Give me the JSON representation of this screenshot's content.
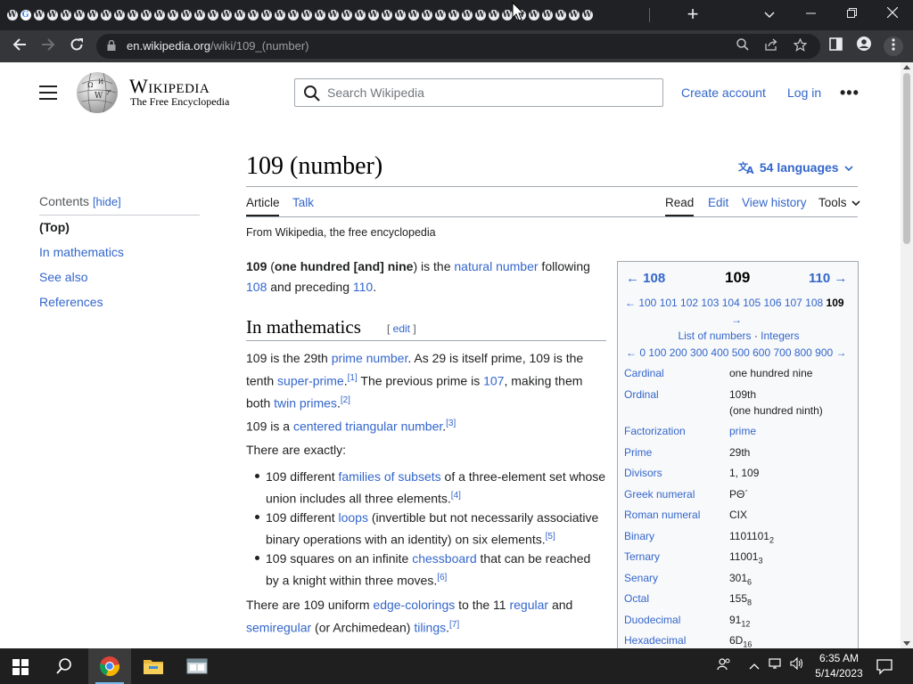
{
  "browser": {
    "tab_count": 44,
    "new_tab": "+",
    "url_host": "en.wikipedia.org",
    "url_path": "/wiki/109_(number)"
  },
  "header": {
    "wordmark": "Wikipedia",
    "tagline": "The Free Encyclopedia",
    "search_placeholder": "Search Wikipedia",
    "create_account": "Create account",
    "login": "Log in",
    "more": "•••"
  },
  "toc": {
    "heading": "Contents",
    "hide": "[hide]",
    "items": [
      "(Top)",
      "In mathematics",
      "See also",
      "References"
    ]
  },
  "article": {
    "title": "109 (number)",
    "languages": "54 languages",
    "tabs": {
      "article": "Article",
      "talk": "Talk",
      "read": "Read",
      "edit": "Edit",
      "history": "View history",
      "tools": "Tools"
    },
    "from": "From Wikipedia, the free encyclopedia",
    "lead": {
      "b1": "109",
      "t1": " (",
      "b2": "one hundred [and] nine",
      "t2": ") is the ",
      "l1": "natural number",
      "t3": " following",
      "l2": "108",
      "t4": " and preceding ",
      "l3": "110",
      "t5": "."
    },
    "section_title": "In mathematics",
    "section_edit": "edit",
    "p1": {
      "t1": "109 is the 29th ",
      "l1": "prime number",
      "t2": ". As 29 is itself prime, 109 is the",
      "t3": "tenth ",
      "l2": "super-prime",
      "s1": "[1]",
      "t4": " The previous prime is ",
      "l3": "107",
      "t5": ", making them",
      "t6": "both ",
      "l4": "twin primes",
      "t7": ".",
      "s2": "[2]"
    },
    "p2": {
      "t1": "109 is a ",
      "l1": "centered triangular number",
      "t2": ".",
      "s1": "[3]"
    },
    "p3": "There are exactly:",
    "bullets": [
      {
        "t1": "109 different ",
        "l1": "families of subsets",
        "t2": " of a three-element set whose",
        "t3": "union includes all three elements.",
        "s1": "[4]"
      },
      {
        "t1": "109 different ",
        "l1": "loops",
        "t2": " (invertible but not necessarily associative",
        "t3": "binary operations with an identity) on six elements.",
        "s1": "[5]"
      },
      {
        "t1": "109 squares on an infinite ",
        "l1": "chessboard",
        "t2": " that can be reached",
        "t3": "by a knight within three moves.",
        "s1": "[6]"
      }
    ],
    "p4": {
      "t1": "There are 109 uniform ",
      "l1": "edge-colorings",
      "t2": " to the 11 ",
      "l2": "regular",
      "t3": " and",
      "l3": "semiregular",
      "t4": " (or Archimedean) ",
      "l4": "tilings",
      "t5": ".",
      "s1": "[7]"
    }
  },
  "infobox": {
    "prev": "← 108",
    "number": "109",
    "next": "110 →",
    "range_links": "← 100 101 102 103 104 105 106 107 108",
    "range_current": "109",
    "range_arrow": "→",
    "list_link": "List of numbers",
    "dot": " · ",
    "integers_link": "Integers",
    "hundreds": "← 0 100 200 300 400 500 600 700 800 900 →",
    "rows": [
      {
        "label": "Cardinal",
        "value": "one hundred nine"
      },
      {
        "label": "Ordinal",
        "value": "109th",
        "value2": "(one hundred ninth)"
      },
      {
        "label": "Factorization",
        "value": "prime"
      },
      {
        "label": "Prime",
        "value": "29th"
      },
      {
        "label": "Divisors",
        "value": "1, 109"
      },
      {
        "label": "Greek numeral",
        "value": "ΡΘ´"
      },
      {
        "label": "Roman numeral",
        "value": "CIX"
      },
      {
        "label": "Binary",
        "value": "1101101",
        "base": "2"
      },
      {
        "label": "Ternary",
        "value": "11001",
        "base": "3"
      },
      {
        "label": "Senary",
        "value": "301",
        "base": "6"
      },
      {
        "label": "Octal",
        "value": "155",
        "base": "8"
      },
      {
        "label": "Duodecimal",
        "value": "91",
        "base": "12"
      },
      {
        "label": "Hexadecimal",
        "value": "6D",
        "base": "16"
      }
    ]
  },
  "taskbar": {
    "time": "6:35 AM",
    "date": "5/14/2023"
  },
  "colors": {
    "link": "#3366cc",
    "chrome_dark": "#202124",
    "toolbar": "#35363a",
    "taskbar": "#1f1f1f"
  }
}
